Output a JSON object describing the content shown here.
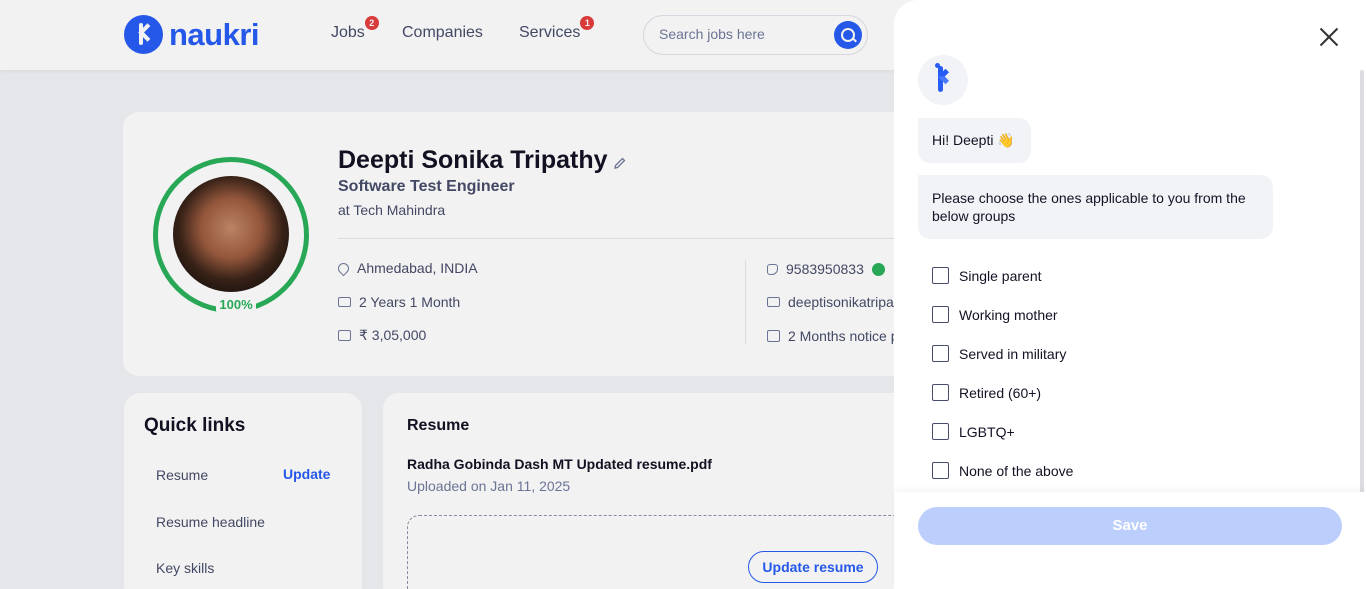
{
  "header": {
    "logo_text": "naukri",
    "nav": [
      {
        "label": "Jobs",
        "badge": "2"
      },
      {
        "label": "Companies",
        "badge": ""
      },
      {
        "label": "Services",
        "badge": "1"
      }
    ],
    "search_placeholder": "Search jobs here"
  },
  "profile": {
    "name": "Deepti Sonika Tripathy",
    "role": "Software Test Engineer",
    "company": "at Tech Mahindra",
    "completion": "100%",
    "location": "Ahmedabad, INDIA",
    "experience": "2 Years 1 Month",
    "salary": "₹ 3,05,000",
    "phone": "9583950833",
    "email": "deeptisonikatripa",
    "notice": "2 Months notice p"
  },
  "quick_links": {
    "title": "Quick links",
    "items": [
      "Resume",
      "Resume headline",
      "Key skills"
    ],
    "update_label": "Update"
  },
  "resume": {
    "title": "Resume",
    "file_name": "Radha Gobinda Dash MT Updated resume.pdf",
    "uploaded": "Uploaded on Jan 11, 2025",
    "update_button": "Update resume"
  },
  "drawer": {
    "greeting": "Hi! Deepti 👋",
    "prompt": "Please choose the ones applicable to you from the below groups",
    "options": [
      "Single parent",
      "Working mother",
      "Served in military",
      "Retired (60+)",
      "LGBTQ+",
      "None of the above"
    ],
    "save_label": "Save"
  },
  "colors": {
    "brand": "#275df5",
    "success": "#2bb25c",
    "save_disabled": "#bccefc"
  }
}
